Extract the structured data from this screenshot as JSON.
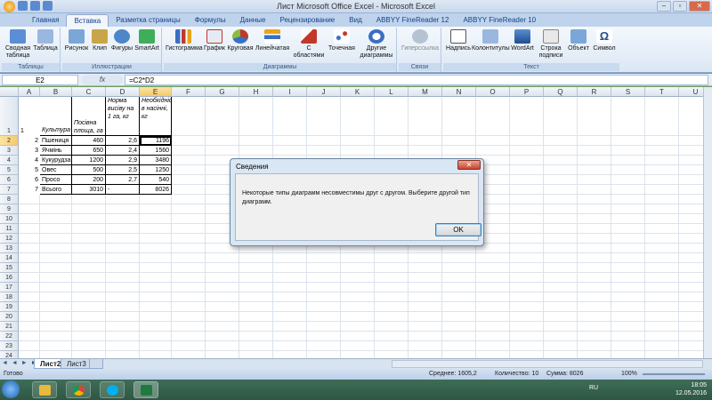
{
  "window": {
    "title": "Лист Microsoft Office Excel - Microsoft Excel",
    "minimize": "–",
    "maximize": "▫",
    "close": "✕"
  },
  "tabs": [
    "Главная",
    "Вставка",
    "Разметка страницы",
    "Формулы",
    "Данные",
    "Рецензирование",
    "Вид",
    "ABBYY FineReader 12",
    "ABBYY FineReader 10"
  ],
  "active_tab": "Вставка",
  "ribbon": {
    "groups": [
      {
        "label": "Таблицы",
        "buttons": [
          "Сводная таблица",
          "Таблица"
        ]
      },
      {
        "label": "Иллюстрации",
        "buttons": [
          "Рисунок",
          "Клип",
          "Фигуры",
          "SmartArt"
        ]
      },
      {
        "label": "Диаграммы",
        "buttons": [
          "Гистограмма",
          "График",
          "Круговая",
          "Линейчатая",
          "С областями",
          "Точечная",
          "Другие диаграммы"
        ]
      },
      {
        "label": "Связи",
        "buttons": [
          "Гиперссылка"
        ]
      },
      {
        "label": "Текст",
        "buttons": [
          "Надпись",
          "Колонтитулы",
          "WordArt",
          "Строка подписи",
          "Объект",
          "Символ"
        ]
      }
    ]
  },
  "formula_bar": {
    "name_box": "E2",
    "fx": "fx",
    "formula": "=C2*D2"
  },
  "columns": [
    "A",
    "B",
    "C",
    "D",
    "E",
    "F",
    "G",
    "H",
    "I",
    "J",
    "K",
    "L",
    "M",
    "N",
    "O",
    "P",
    "Q",
    "R",
    "S",
    "T",
    "U"
  ],
  "rows": [
    "1",
    "2",
    "3",
    "4",
    "5",
    "6",
    "7",
    "8",
    "9",
    "10",
    "11",
    "12",
    "13",
    "14",
    "15",
    "16",
    "17",
    "18",
    "19",
    "20",
    "21",
    "22",
    "23",
    "24",
    "25"
  ],
  "table": {
    "header": {
      "a": "1",
      "b": "Культура",
      "c": "Посівна площа, га",
      "d": "Норма висіву на 1 га, кг",
      "e": "Необхідність в насінні, кг"
    },
    "rows": [
      {
        "a": "2",
        "b": "Пшениця",
        "c": "460",
        "d": "2,6",
        "e": "1196"
      },
      {
        "a": "3",
        "b": "Ячмінь",
        "c": "650",
        "d": "2,4",
        "e": "1560"
      },
      {
        "a": "4",
        "b": "Кукурудза",
        "c": "1200",
        "d": "2,9",
        "e": "3480"
      },
      {
        "a": "5",
        "b": "Овес",
        "c": "500",
        "d": "2,5",
        "e": "1250"
      },
      {
        "a": "6",
        "b": "Просо",
        "c": "200",
        "d": "2,7",
        "e": "540"
      },
      {
        "a": "7",
        "b": "Всього",
        "c": "3010",
        "d": "-",
        "e": "8026"
      }
    ]
  },
  "sheets": [
    "Лист2",
    "Лист3"
  ],
  "active_sheet": "Лист2",
  "sheet_nav": "◄ ◄ ► ►",
  "status": {
    "left": "Готово",
    "avg": "Среднее: 1605,2",
    "count": "Количество: 10",
    "sum": "Сумма: 8026",
    "zoom": "100%"
  },
  "dialog": {
    "title": "Сведения",
    "message": "Некоторые типы диаграмм несовместимы друг с другом. Выберите другой тип диаграмм.",
    "ok": "OK",
    "close": "✕"
  },
  "taskbar": {
    "lang": "RU",
    "time": "18:05",
    "date": "12.05.2016"
  },
  "colors": {
    "accent": "#15428b",
    "selected_header": "#f7c96a",
    "taskbar": "#2e5744"
  }
}
